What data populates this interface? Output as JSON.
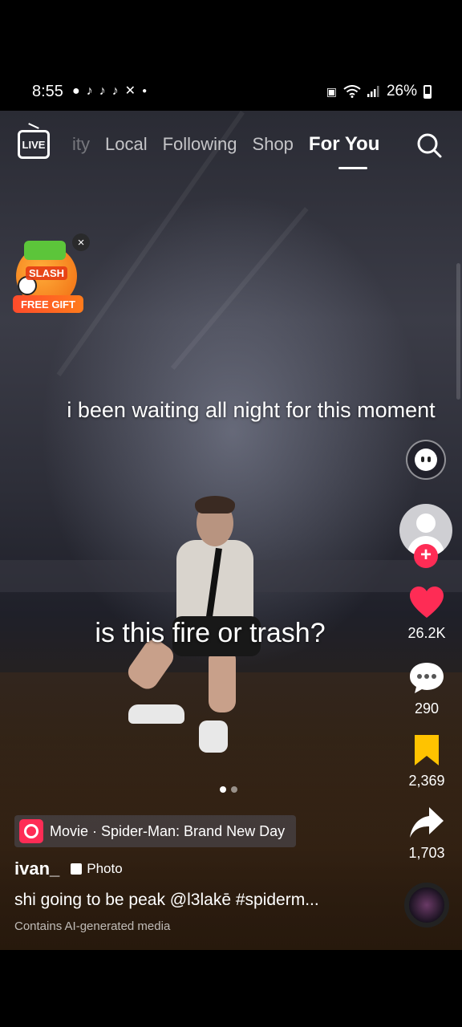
{
  "status_bar": {
    "time": "8:55",
    "left_icons": [
      "chat-bubble-icon",
      "tiktok-icon",
      "tiktok-icon",
      "tiktok-icon",
      "capcut-icon",
      "dot-icon"
    ],
    "battery": "26%",
    "right_icons": [
      "battery-saver-icon",
      "wifi-icon",
      "signal-icon",
      "battery-icon"
    ]
  },
  "top_nav": {
    "live_label": "LIVE",
    "tabs": [
      {
        "label": "ity",
        "state": "faded"
      },
      {
        "label": "Local",
        "state": "normal"
      },
      {
        "label": "Following",
        "state": "normal"
      },
      {
        "label": "Shop",
        "state": "normal"
      },
      {
        "label": "For You",
        "state": "active"
      }
    ]
  },
  "gift_promo": {
    "badge": "SLASH",
    "label": "FREE GIFT",
    "close": "×"
  },
  "captions": {
    "top": "i been waiting all night for this moment",
    "middle": "is this fire or trash?"
  },
  "side_rail": {
    "follow_symbol": "+",
    "likes": "26.2K",
    "comments": "290",
    "saves": "2,369",
    "shares": "1,703",
    "colors": {
      "like": "#fe2c55",
      "save": "#ffc300"
    }
  },
  "post": {
    "movie_chip": "Movie · Spider-Man: Brand New Day",
    "author": "ivan_",
    "type_tag": "Photo",
    "description": "shi going to be peak @l3lakē #spiderm...",
    "ai_note": "Contains AI-generated media"
  },
  "carousel": {
    "count": 2,
    "active": 1
  }
}
